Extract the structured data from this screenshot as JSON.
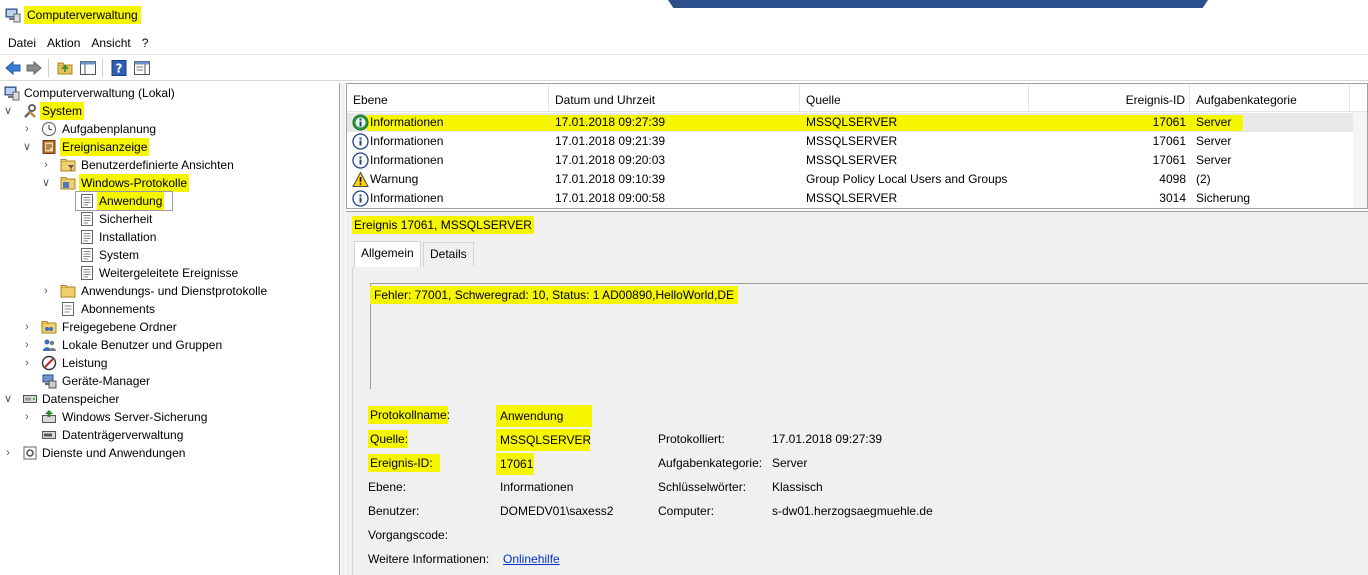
{
  "window": {
    "title": "Computerverwaltung"
  },
  "menu": [
    "Datei",
    "Aktion",
    "Ansicht",
    "?"
  ],
  "toolbar": {
    "buttons": [
      "back-icon",
      "forward-icon",
      "up-folder-icon",
      "console-tree-icon",
      "help-icon",
      "properties-icon"
    ]
  },
  "tree": {
    "root": "Computerverwaltung (Lokal)",
    "system": "System",
    "aufgabenplanung": "Aufgabenplanung",
    "ereignisanzeige": "Ereignisanzeige",
    "benutzerdefinierte": "Benutzerdefinierte Ansichten",
    "windows_protokolle": "Windows-Protokolle",
    "anwendung": "Anwendung",
    "sicherheit": "Sicherheit",
    "installation": "Installation",
    "system_log": "System",
    "weitergeleitete": "Weitergeleitete Ereignisse",
    "anwendungs_dienst": "Anwendungs- und Dienstprotokolle",
    "abonnements": "Abonnements",
    "freigegebene": "Freigegebene Ordner",
    "lokale_benutzer": "Lokale Benutzer und Gruppen",
    "leistung": "Leistung",
    "geraete_manager": "Geräte-Manager",
    "datenspeicher": "Datenspeicher",
    "server_sicherung": "Windows Server-Sicherung",
    "datentraeger": "Datenträgerverwaltung",
    "dienste": "Dienste und Anwendungen"
  },
  "events": {
    "columns": [
      "Ebene",
      "Datum und Uhrzeit",
      "Quelle",
      "Ereignis-ID",
      "Aufgabenkategorie"
    ],
    "rows": [
      {
        "icon": "info-icon",
        "ebene": "Informationen",
        "datum": "17.01.2018 09:27:39",
        "quelle": "MSSQLSERVER",
        "id": "17061",
        "kategorie": "Server"
      },
      {
        "icon": "info-icon",
        "ebene": "Informationen",
        "datum": "17.01.2018 09:21:39",
        "quelle": "MSSQLSERVER",
        "id": "17061",
        "kategorie": "Server"
      },
      {
        "icon": "info-icon",
        "ebene": "Informationen",
        "datum": "17.01.2018 09:20:03",
        "quelle": "MSSQLSERVER",
        "id": "17061",
        "kategorie": "Server"
      },
      {
        "icon": "warning-icon",
        "ebene": "Warnung",
        "datum": "17.01.2018 09:10:39",
        "quelle": "Group Policy Local Users and Groups",
        "id": "4098",
        "kategorie": "(2)"
      },
      {
        "icon": "info-icon",
        "ebene": "Informationen",
        "datum": "17.01.2018 09:00:58",
        "quelle": "MSSQLSERVER",
        "id": "3014",
        "kategorie": "Sicherung"
      }
    ]
  },
  "detail": {
    "title": "Ereignis 17061, MSSQLSERVER",
    "tabs": [
      "Allgemein",
      "Details"
    ],
    "message": "Fehler: 77001, Schweregrad: 10, Status: 1 AD00890,HelloWorld,DE",
    "labels": {
      "protokollname": "Protokollname:",
      "quelle": "Quelle:",
      "ereignis_id": "Ereignis-ID:",
      "ebene": "Ebene:",
      "benutzer": "Benutzer:",
      "vorgangscode": "Vorgangscode:",
      "weitere": "Weitere Informationen:",
      "protokolliert": "Protokolliert:",
      "aufgabenkategorie": "Aufgabenkategorie:",
      "schluesselwoerter": "Schlüsselwörter:",
      "computer": "Computer:"
    },
    "values": {
      "protokollname": "Anwendung",
      "quelle": "MSSQLSERVER",
      "ereignis_id": "17061",
      "ebene": "Informationen",
      "benutzer": "DOMEDV01\\saxess2",
      "weitere": "Onlinehilfe",
      "protokolliert": "17.01.2018 09:27:39",
      "aufgabenkategorie": "Server",
      "schluesselwoerter": "Klassisch",
      "computer": "s-dw01.herzogsaegmuehle.de"
    }
  },
  "colors": {
    "highlight": "#f6f600",
    "link": "#0033cc",
    "panel": "#f0f0f0"
  }
}
